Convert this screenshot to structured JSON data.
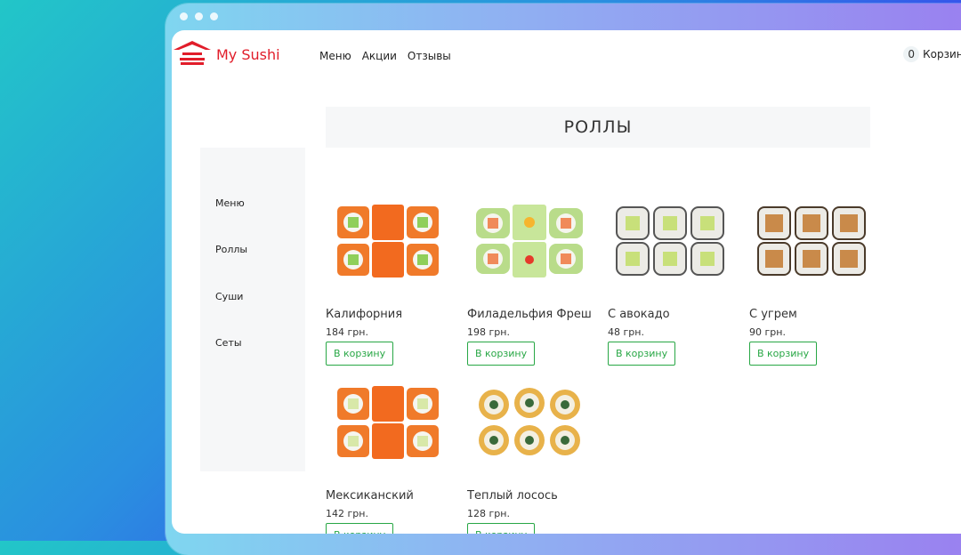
{
  "brand": {
    "name": "My Sushi",
    "logo_icon": "pagoda-icon",
    "color": "#e11d2a"
  },
  "nav": {
    "items": [
      "Меню",
      "Акции",
      "Отзывы"
    ]
  },
  "cart": {
    "count": "0",
    "label": "Корзина"
  },
  "sidebar": {
    "items": [
      "Меню",
      "Роллы",
      "Суши",
      "Сеты"
    ]
  },
  "section": {
    "title": "РОЛЛЫ"
  },
  "products": [
    {
      "name": "Калифорния",
      "price": "184 грн.",
      "button": "В корзину",
      "style": "orange-avocado"
    },
    {
      "name": "Филадельфия Фреш",
      "price": "198 грн.",
      "button": "В корзину",
      "style": "green-salmon"
    },
    {
      "name": "С авокадо",
      "price": "48 грн.",
      "button": "В корзину",
      "style": "white-avocado"
    },
    {
      "name": "С угрем",
      "price": "90 грн.",
      "button": "В корзину",
      "style": "eel"
    },
    {
      "name": "Мексиканский",
      "price": "142 грн.",
      "button": "В корзину",
      "style": "orange-cucumber"
    },
    {
      "name": "Теплый лосось",
      "price": "128 грн.",
      "button": "В корзину",
      "style": "tempura"
    }
  ],
  "accent_color": "#28a745"
}
